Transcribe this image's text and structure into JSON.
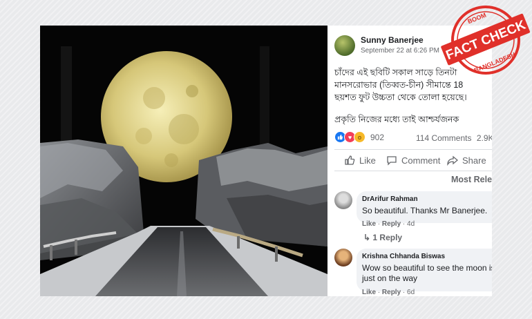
{
  "post": {
    "author": "Sunny Banerjee",
    "timestamp": "September 22 at 6:26 PM",
    "text_lines": [
      "চাঁদের এই ছবিটি সকাল সাড়ে তিনটা",
      "মানসরোভার (তিব্বত-চীন) সীমান্তে 18",
      "ছয়শত ফুট উচ্চতা থেকে তোলা হয়েছে।"
    ],
    "text_line2": "প্রকৃতি নিজের মধ্যে তাই আশ্চর্যজনক",
    "reaction_count": "902",
    "comments_count": "114 Comments",
    "shares_count": "2.9K",
    "actions": {
      "like": "Like",
      "comment": "Comment",
      "share": "Share"
    },
    "sort_label": "Most Relev"
  },
  "comments": [
    {
      "name": "DrArifur Rahman",
      "text": "So beautiful. Thanks Mr Banerjee.",
      "like": "Like",
      "reply": "Reply",
      "age": "4d",
      "replies": "1 Reply"
    },
    {
      "name": "Krishna Chhanda Biswas",
      "text": "Wow so beautiful to see the moon is just on the way",
      "like": "Like",
      "reply": "Reply",
      "age": "6d"
    }
  ],
  "stamp": {
    "top": "BOOM",
    "main": "FACT CHECK",
    "bottom": "BANGLADESH",
    "color": "#e0302a"
  },
  "icons": [
    "like-icon",
    "love-icon",
    "wow-icon",
    "comment-icon",
    "share-icon"
  ]
}
